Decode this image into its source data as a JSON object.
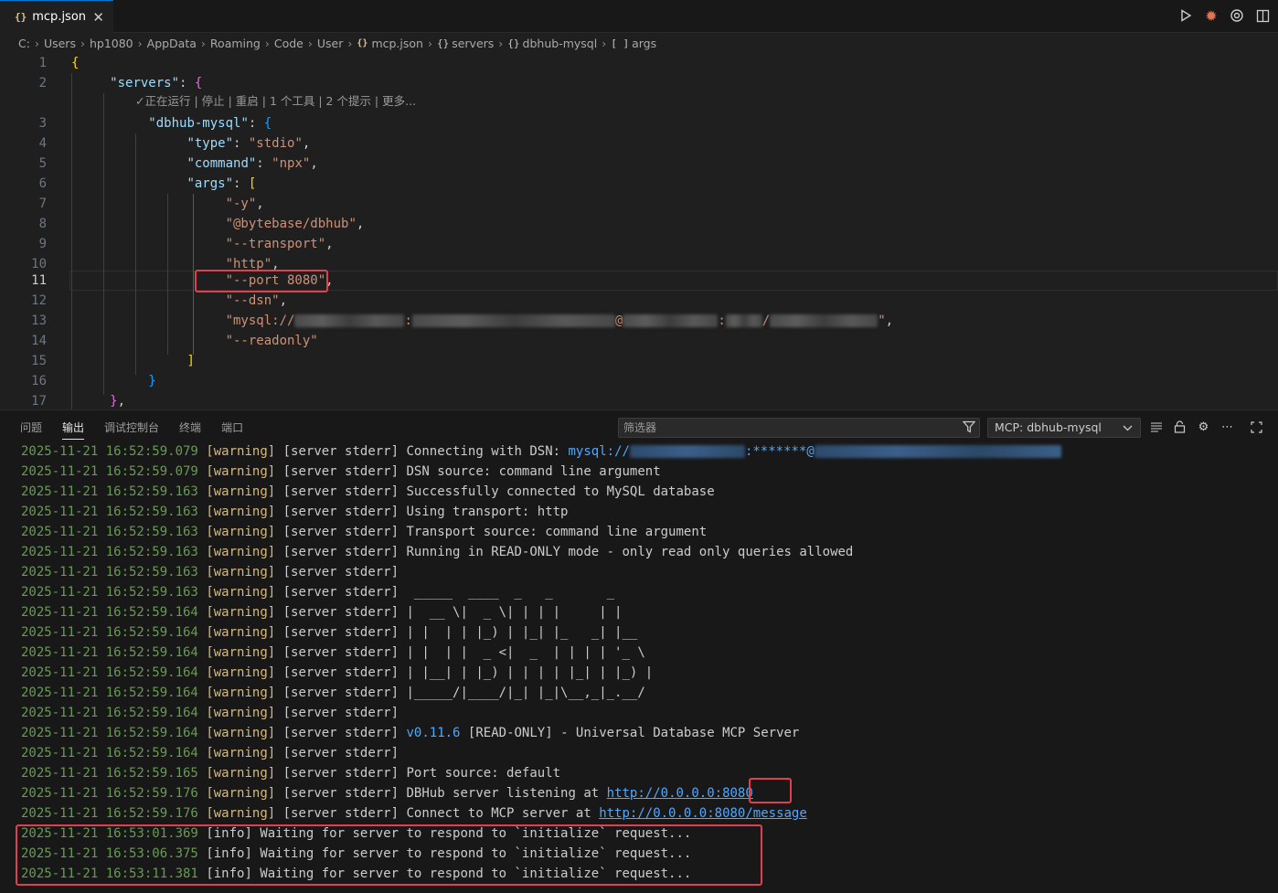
{
  "tab": {
    "title": "mcp.json",
    "icon": "json-braces-icon",
    "close": "✕"
  },
  "breadcrumb": [
    "C:",
    "Users",
    "hp1080",
    "AppData",
    "Roaming",
    "Code",
    "User",
    "mcp.json",
    "servers",
    "dbhub-mysql",
    "args"
  ],
  "editor": {
    "codelens": "✓正在运行 | 停止 | 重启 | 1 个工具 | 2 个提示 | 更多...",
    "line_numbers": [
      "1",
      "2",
      "3",
      "4",
      "5",
      "6",
      "7",
      "8",
      "9",
      "10",
      "11",
      "12",
      "13",
      "14",
      "15",
      "16",
      "17"
    ],
    "current_line": "11",
    "servers_key": "\"servers\"",
    "server_key": "\"dbhub-mysql\"",
    "type_key": "\"type\"",
    "type_val": "\"stdio\"",
    "command_key": "\"command\"",
    "command_val": "\"npx\"",
    "args_key": "\"args\"",
    "args": [
      "\"-y\"",
      "\"@bytebase/dbhub\"",
      "\"--transport\"",
      "\"http\"",
      "\"--port 8080\"",
      "\"--dsn\"",
      "\"mysql://",
      "\"--readonly\""
    ],
    "mysql_seps": [
      ":",
      "@",
      ":",
      "/",
      "\""
    ]
  },
  "panel": {
    "tabs": [
      "问题",
      "输出",
      "调试控制台",
      "终端",
      "端口"
    ],
    "active_tab": "输出",
    "filter_placeholder": "筛选器",
    "channel": "MCP: dbhub-mysql"
  },
  "output": [
    {
      "ts": "2025-11-21 16:52:59.079",
      "lvl": "[warning]",
      "src": "[server stderr]",
      "msg": "Connecting with DSN: "
    },
    {
      "ts": "2025-11-21 16:52:59.079",
      "lvl": "[warning]",
      "src": "[server stderr]",
      "msg": "DSN source: command line argument"
    },
    {
      "ts": "2025-11-21 16:52:59.163",
      "lvl": "[warning]",
      "src": "[server stderr]",
      "msg": "Successfully connected to MySQL database"
    },
    {
      "ts": "2025-11-21 16:52:59.163",
      "lvl": "[warning]",
      "src": "[server stderr]",
      "msg": "Using transport: http"
    },
    {
      "ts": "2025-11-21 16:52:59.163",
      "lvl": "[warning]",
      "src": "[server stderr]",
      "msg": "Transport source: command line argument"
    },
    {
      "ts": "2025-11-21 16:52:59.163",
      "lvl": "[warning]",
      "src": "[server stderr]",
      "msg": "Running in READ-ONLY mode - only read only queries allowed"
    },
    {
      "ts": "2025-11-21 16:52:59.163",
      "lvl": "[warning]",
      "src": "[server stderr]",
      "msg": ""
    },
    {
      "ts": "2025-11-21 16:52:59.163",
      "lvl": "[warning]",
      "src": "[server stderr]",
      "msg": " _____  ____  _   _       _"
    },
    {
      "ts": "2025-11-21 16:52:59.164",
      "lvl": "[warning]",
      "src": "[server stderr]",
      "msg": "|  __ \\|  _ \\| | | |     | |"
    },
    {
      "ts": "2025-11-21 16:52:59.164",
      "lvl": "[warning]",
      "src": "[server stderr]",
      "msg": "| |  | | |_) | |_| |_   _| |__"
    },
    {
      "ts": "2025-11-21 16:52:59.164",
      "lvl": "[warning]",
      "src": "[server stderr]",
      "msg": "| |  | |  _ <|  _  | | | | '_ \\"
    },
    {
      "ts": "2025-11-21 16:52:59.164",
      "lvl": "[warning]",
      "src": "[server stderr]",
      "msg": "| |__| | |_) | | | | |_| | |_) |"
    },
    {
      "ts": "2025-11-21 16:52:59.164",
      "lvl": "[warning]",
      "src": "[server stderr]",
      "msg": "|_____/|____/|_| |_|\\__,_|_.__/"
    },
    {
      "ts": "2025-11-21 16:52:59.164",
      "lvl": "[warning]",
      "src": "[server stderr]",
      "msg": ""
    },
    {
      "ts": "2025-11-21 16:52:59.164",
      "lvl": "[warning]",
      "src": "[server stderr]",
      "msg": " [READ-ONLY] - Universal Database MCP Server",
      "ver": "v0.11.6"
    },
    {
      "ts": "2025-11-21 16:52:59.164",
      "lvl": "[warning]",
      "src": "[server stderr]",
      "msg": ""
    },
    {
      "ts": "2025-11-21 16:52:59.165",
      "lvl": "[warning]",
      "src": "[server stderr]",
      "msg": "Port source: default"
    },
    {
      "ts": "2025-11-21 16:52:59.176",
      "lvl": "[warning]",
      "src": "[server stderr]",
      "msg": "DBHub server listening at ",
      "link": "http://0.0.0.0:8080"
    },
    {
      "ts": "2025-11-21 16:52:59.176",
      "lvl": "[warning]",
      "src": "[server stderr]",
      "msg": "Connect to MCP server at ",
      "link": "http://0.0.0.0:8080/message"
    },
    {
      "ts": "2025-11-21 16:53:01.369",
      "lvl": "[info]",
      "src": "",
      "msg": "Waiting for server to respond to `initialize` request..."
    },
    {
      "ts": "2025-11-21 16:53:06.375",
      "lvl": "[info]",
      "src": "",
      "msg": "Waiting for server to respond to `initialize` request..."
    },
    {
      "ts": "2025-11-21 16:53:11.381",
      "lvl": "[info]",
      "src": "",
      "msg": "Waiting for server to respond to `initialize` request..."
    }
  ],
  "dsn_prefix": "mysql://",
  "dsn_mask": ":*******@"
}
